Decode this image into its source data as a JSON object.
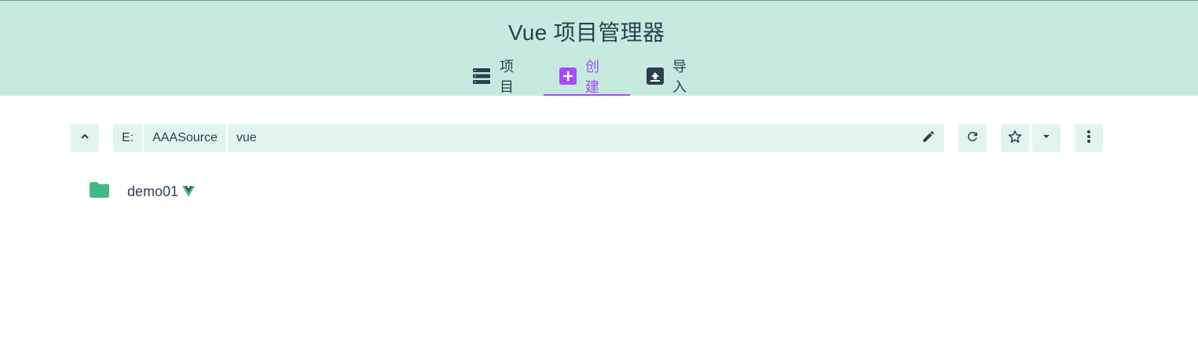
{
  "app": {
    "title": "Vue 项目管理器"
  },
  "tabs": [
    {
      "label": "项目",
      "icon": "list-icon",
      "active": false
    },
    {
      "label": "创建",
      "icon": "add-box-icon",
      "active": true
    },
    {
      "label": "导入",
      "icon": "unarchive-icon",
      "active": false
    }
  ],
  "path": {
    "segments": [
      "E:",
      "AAASource",
      "vue"
    ]
  },
  "toolbar": {
    "up_icon": "chevron-up-icon",
    "edit_icon": "pencil-icon",
    "refresh_icon": "refresh-icon",
    "favorite_icon": "star-outline-icon",
    "favorites_menu_icon": "caret-down-icon",
    "more_icon": "more-vert-icon"
  },
  "folders": [
    {
      "name": "demo01",
      "is_vue_project": true
    }
  ],
  "colors": {
    "header_bg": "#c6eadf",
    "accent": "#a44cf6",
    "button_bg": "#e1f5ee",
    "folder": "#42b983",
    "text": "#2c3e50"
  }
}
